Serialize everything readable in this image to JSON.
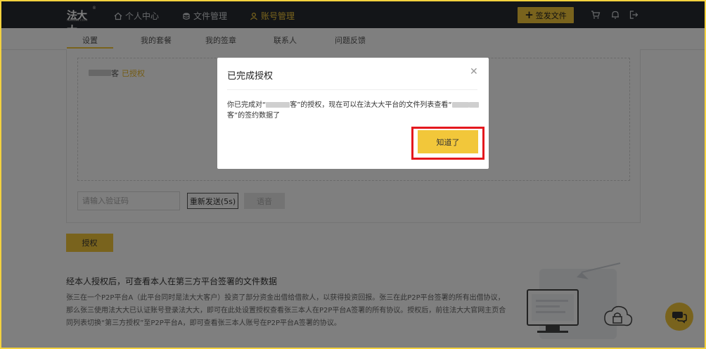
{
  "colors": {
    "accent": "#f2c73a",
    "nav_bg": "#262a30",
    "highlight_border": "#e4181e"
  },
  "topbar": {
    "logo_text": "法大大",
    "logo_sub": "fadada.com",
    "nav": [
      {
        "label": "个人中心",
        "icon": "home-icon"
      },
      {
        "label": "文件管理",
        "icon": "database-icon"
      },
      {
        "label": "账号管理",
        "icon": "user-icon",
        "active": true
      }
    ],
    "sign_button": "签发文件",
    "icons": [
      "cart-icon",
      "bell-icon",
      "logout-icon"
    ]
  },
  "subtabs": [
    "设置",
    "我的套餐",
    "我的签章",
    "联系人",
    "问题反馈"
  ],
  "auth": {
    "name_suffix": "客",
    "status": "已授权",
    "code_placeholder": "请输入验证码",
    "resend_label": "重新发送(5s)",
    "voice_label": "语音"
  },
  "authorize_button": "授权",
  "info": {
    "title": "经本人授权后，可查看本人在第三方平台签署的文件数据",
    "desc": "张三在一个P2P平台A（此平台同时是法大大客户）投资了部分资金出借给借款人，以获得投资回报。张三在此P2P平台签署的所有出借协议，那么张三使用法大大已认证账号登录法大大，即可在此处设置授权查看张三本人在P2P平台A签署的所有协议。授权后，前往法大大官网主页合同列表切换“第三方授权”至P2P平台A，即可查看张三本人账号在P2P平台A签署的协议。"
  },
  "modal": {
    "title": "已完成授权",
    "msg_1": "你已完成对“",
    "msg_name_1": "客",
    "msg_2": "”的授权，现在可以在法大大平台的文件列表查看“",
    "msg_name_2": "客",
    "msg_3": "”的签约数据了",
    "ok_button": "知道了"
  }
}
